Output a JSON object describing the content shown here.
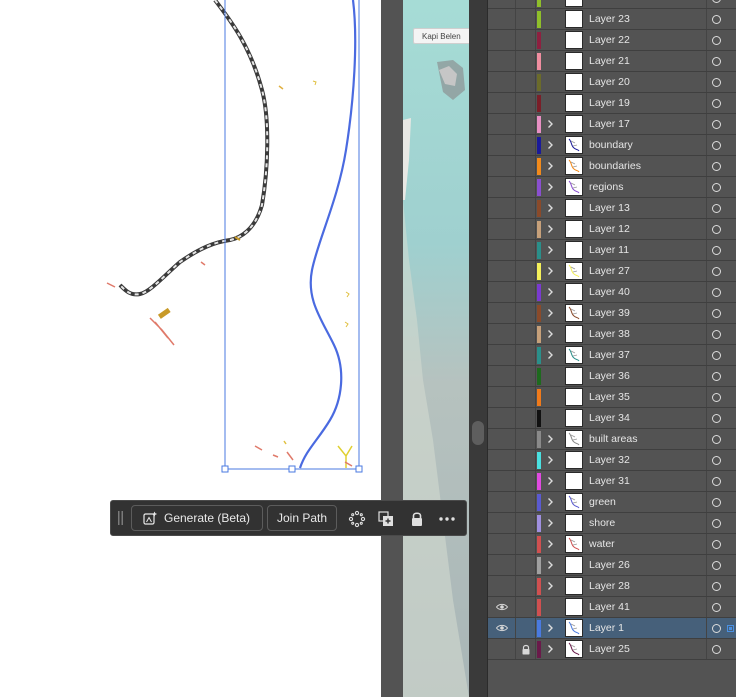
{
  "context_toolbar": {
    "generate_label": "Generate (Beta)",
    "join_path_label": "Join Path",
    "icons": [
      "grip-icon",
      "sparkle-generate-icon",
      "path-anchors-icon",
      "duplicate-icon",
      "lock-icon",
      "more-options-icon"
    ]
  },
  "map_preview": {
    "label": "Kapi Belen"
  },
  "layers": [
    {
      "name": "Layer 23",
      "color": "#8fbf2a",
      "expand": false,
      "thumb": "blank"
    },
    {
      "name": "Layer 22",
      "color": "#8e2040",
      "expand": false,
      "thumb": "blank"
    },
    {
      "name": "Layer 21",
      "color": "#f08ea0",
      "expand": false,
      "thumb": "blank"
    },
    {
      "name": "Layer 20",
      "color": "#6b6b2a",
      "expand": false,
      "thumb": "blank"
    },
    {
      "name": "Layer 19",
      "color": "#7a1e28",
      "expand": false,
      "thumb": "blank"
    },
    {
      "name": "Layer 17",
      "color": "#e890c4",
      "expand": true,
      "thumb": "blank"
    },
    {
      "name": "boundary",
      "color": "#1a1a9a",
      "expand": true,
      "thumb": "art"
    },
    {
      "name": "boundaries",
      "color": "#f28a1a",
      "expand": true,
      "thumb": "art"
    },
    {
      "name": "regions",
      "color": "#8a4fd0",
      "expand": true,
      "thumb": "art"
    },
    {
      "name": "Layer 13",
      "color": "#8a4a2a",
      "expand": true,
      "thumb": "blank"
    },
    {
      "name": "Layer 12",
      "color": "#c6a07a",
      "expand": true,
      "thumb": "blank"
    },
    {
      "name": "Layer 11",
      "color": "#2a8f8a",
      "expand": true,
      "thumb": "blank"
    },
    {
      "name": "Layer 27",
      "color": "#f4f05a",
      "expand": true,
      "thumb": "art"
    },
    {
      "name": "Layer 40",
      "color": "#7a3ad0",
      "expand": true,
      "thumb": "blank"
    },
    {
      "name": "Layer 39",
      "color": "#8a4a2a",
      "expand": true,
      "thumb": "art"
    },
    {
      "name": "Layer 38",
      "color": "#c6a07a",
      "expand": true,
      "thumb": "blank"
    },
    {
      "name": "Layer 37",
      "color": "#2a8f8a",
      "expand": true,
      "thumb": "art"
    },
    {
      "name": "Layer 36",
      "color": "#1e6a1e",
      "expand": false,
      "thumb": "blank"
    },
    {
      "name": "Layer 35",
      "color": "#f07a1a",
      "expand": false,
      "thumb": "blank"
    },
    {
      "name": "Layer 34",
      "color": "#111111",
      "expand": false,
      "thumb": "blank"
    },
    {
      "name": "built areas",
      "color": "#8a8a8a",
      "expand": true,
      "thumb": "art"
    },
    {
      "name": "Layer 32",
      "color": "#4ae0e0",
      "expand": true,
      "thumb": "blank"
    },
    {
      "name": "Layer 31",
      "color": "#e04ae0",
      "expand": true,
      "thumb": "blank"
    },
    {
      "name": "green",
      "color": "#5a5ad0",
      "expand": true,
      "thumb": "art"
    },
    {
      "name": "shore",
      "color": "#a090e0",
      "expand": true,
      "thumb": "blank"
    },
    {
      "name": "water",
      "color": "#d05050",
      "expand": true,
      "thumb": "art"
    },
    {
      "name": "Layer 26",
      "color": "#a0a0a0",
      "expand": true,
      "thumb": "blank"
    },
    {
      "name": "Layer 28",
      "color": "#d05050",
      "expand": true,
      "thumb": "blank"
    },
    {
      "name": "Layer 41",
      "color": "#d05050",
      "expand": false,
      "thumb": "blank",
      "visible": true
    },
    {
      "name": "Layer 1",
      "color": "#4a7ae0",
      "expand": true,
      "thumb": "art",
      "visible": true,
      "selected": true
    },
    {
      "name": "Layer 25",
      "color": "#6a1a4a",
      "expand": true,
      "thumb": "art",
      "locked": true
    }
  ]
}
